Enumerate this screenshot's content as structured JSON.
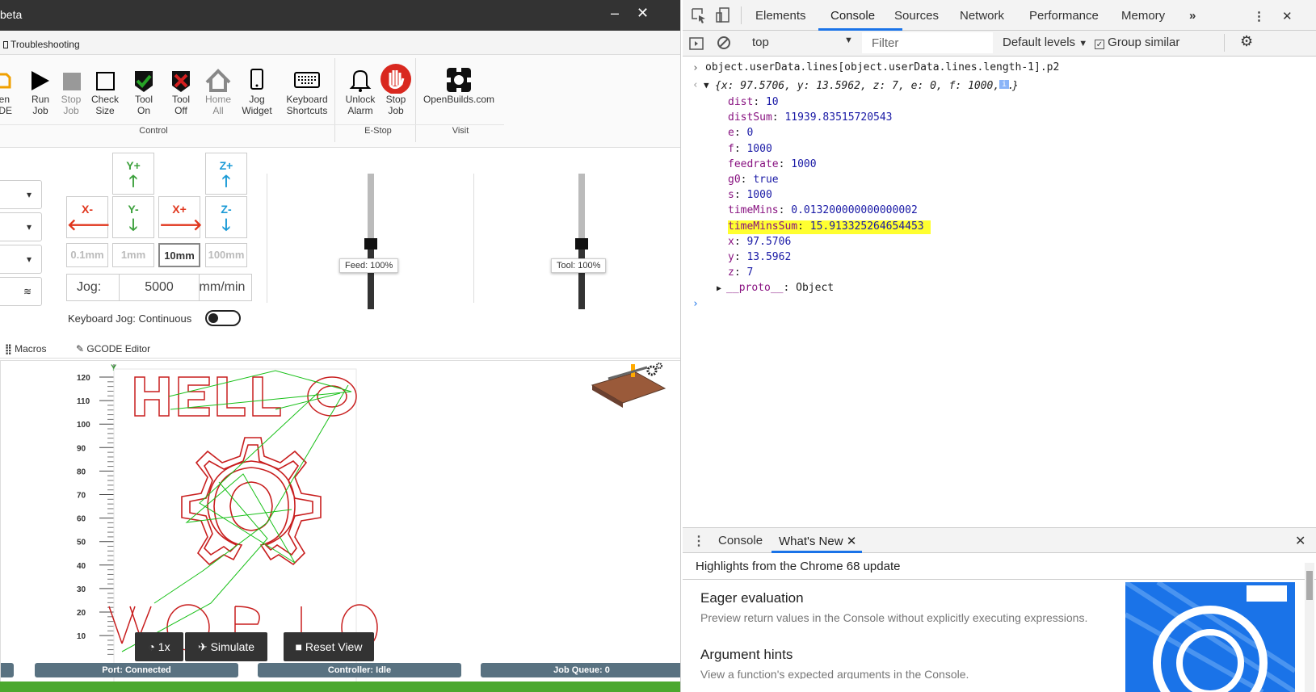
{
  "app": {
    "title": "beta",
    "min_glyph": "–",
    "close_glyph": "✕",
    "tab_troubleshooting": "Troubleshooting",
    "ribbon": [
      {
        "label1": "pen",
        "label2": "ODE",
        "icon": "folder-open-icon"
      },
      {
        "label1": "Run",
        "label2": "Job",
        "icon": "play-icon"
      },
      {
        "label1": "Stop",
        "label2": "Job",
        "icon": "stop-icon"
      },
      {
        "label1": "Check",
        "label2": "Size",
        "icon": "square-icon"
      },
      {
        "label1": "Tool",
        "label2": "On",
        "icon": "tool-on-icon"
      },
      {
        "label1": "Tool",
        "label2": "Off",
        "icon": "tool-off-icon"
      },
      {
        "label1": "Home",
        "label2": "All",
        "icon": "home-icon"
      },
      {
        "label1": "Jog",
        "label2": "Widget",
        "icon": "phone-icon"
      },
      {
        "label1": "Keyboard",
        "label2": "Shortcuts",
        "icon": "keyboard-icon"
      },
      {
        "label1": "Unlock",
        "label2": "Alarm",
        "icon": "bell-icon"
      },
      {
        "label1": "Stop",
        "label2": "Job",
        "icon": "estop-hand-icon"
      },
      {
        "label1": "OpenBuilds.com",
        "label2": "",
        "icon": "openbuilds-logo-icon"
      }
    ],
    "groups": {
      "control": "Control",
      "estop": "E-Stop",
      "visit": "Visit"
    },
    "jog": {
      "yplus": "Y+",
      "yminus": "Y-",
      "xminus": "X-",
      "xplus": "X+",
      "zplus": "Z+",
      "zminus": "Z-",
      "steps": [
        "0.1mm",
        "1mm",
        "10mm",
        "100mm"
      ],
      "jog_label": "Jog:",
      "jog_value": "5000",
      "jog_unit": "mm/min",
      "keyboard_jog": "Keyboard Jog: Continuous",
      "feed_tip": "Feed: 100%",
      "tool_tip": "Tool: 100%",
      "feed_level": 0.5,
      "tool_level": 0.5
    },
    "subtabs": {
      "macros": "Macros",
      "gcode_editor": "GCODE Editor"
    },
    "viewer": {
      "y_axis": "Y",
      "y_ticks": [
        "120",
        "110",
        "100",
        "90",
        "80",
        "70",
        "60",
        "50",
        "40",
        "30",
        "20",
        "10"
      ],
      "btn_speed": "1x",
      "btn_simulate": "Simulate",
      "btn_reset": "Reset View"
    },
    "status": {
      "port": "Port: Connected",
      "controller": "Controller: Idle",
      "queue": "Job Queue: 0"
    }
  },
  "devtools": {
    "tabs": [
      "Elements",
      "Console",
      "Sources",
      "Network",
      "Performance",
      "Memory"
    ],
    "more": "»",
    "context": "top",
    "filter_placeholder": "Filter",
    "levels": "Default levels",
    "group_similar": "Group similar",
    "command": "object.userData.lines[object.userData.lines.length-1].p2",
    "summary": "{x: 97.5706, y: 13.5962, z: 7, e: 0, f: 1000, …}",
    "props": [
      {
        "key": "dist",
        "value": "10"
      },
      {
        "key": "distSum",
        "value": "11939.83515720543"
      },
      {
        "key": "e",
        "value": "0"
      },
      {
        "key": "f",
        "value": "1000"
      },
      {
        "key": "feedrate",
        "value": "1000"
      },
      {
        "key": "g0",
        "value": "true"
      },
      {
        "key": "s",
        "value": "1000"
      },
      {
        "key": "timeMins",
        "value": "0.013200000000000002"
      },
      {
        "key": "timeMinsSum",
        "value": "15.913325264654453"
      },
      {
        "key": "x",
        "value": "97.5706"
      },
      {
        "key": "y",
        "value": "13.5962"
      },
      {
        "key": "z",
        "value": "7"
      },
      {
        "key": "__proto__",
        "value": "Object"
      }
    ],
    "drawer_tabs": [
      "Console",
      "What's New"
    ],
    "drawer_title": "Highlights from the Chrome 68 update",
    "features": [
      {
        "title": "Eager evaluation",
        "desc": "Preview return values in the Console without explicitly executing expressions."
      },
      {
        "title": "Argument hints",
        "desc": "View a function's expected arguments in the Console."
      }
    ]
  },
  "colors": {
    "titlebar": "#333333",
    "status": "#597281",
    "green": "#4ba82e",
    "accent": "#1a73e8",
    "highlight": "#ffff30",
    "toolpath": "#c81e1e",
    "travel": "#18c018"
  }
}
